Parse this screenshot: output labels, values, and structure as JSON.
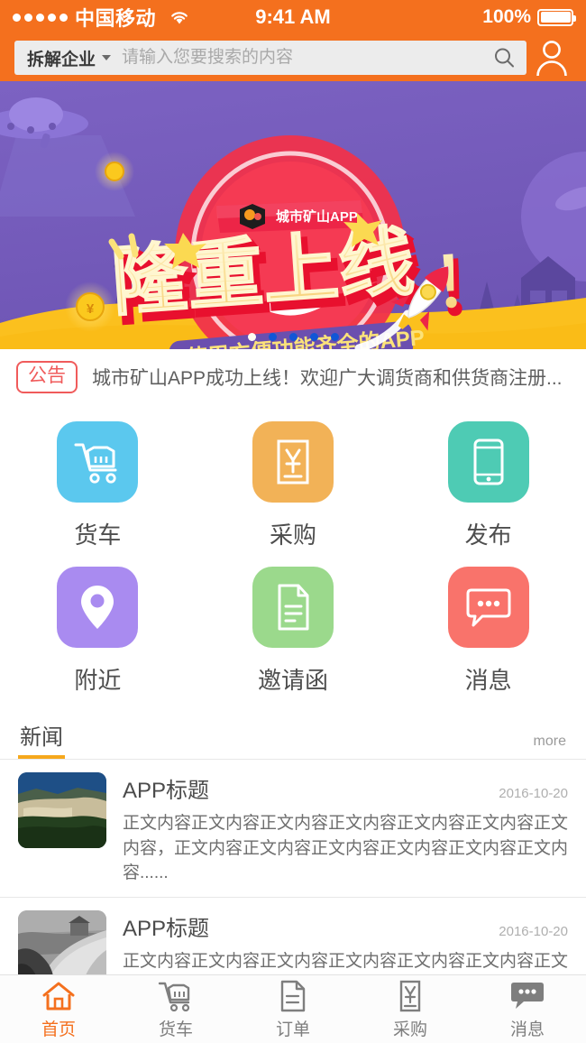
{
  "theme": {
    "accent": "#F4701E",
    "banner_purple": "#7159B8",
    "banner_yellow": "#FBC01E",
    "banner_red": "#F0314B",
    "notice_red": "#F05B5B",
    "news_underline": "#F6A81C"
  },
  "status_bar": {
    "signal_dots": 5,
    "carrier": "中国移动",
    "wifi_icon": "wifi-icon",
    "time": "9:41 AM",
    "battery_percent": "100%",
    "battery_icon": "battery-full-icon"
  },
  "header": {
    "category": {
      "label": "拆解企业",
      "caret_icon": "chevron-down-icon"
    },
    "search": {
      "value": "",
      "placeholder": "请输入您要搜索的内容",
      "icon": "search-icon"
    },
    "profile_icon": "user-avatar-icon"
  },
  "banner": {
    "logo_badge": "城市矿山APP",
    "headline": "隆重上线！",
    "subhead": "使用方便功能齐全的APP",
    "decor_icons": [
      "ufo-icon",
      "coin-icon",
      "rocket-icon",
      "star-icon",
      "tree-icon",
      "house-icon",
      "planet-icon",
      "pylon-icon"
    ],
    "dots": {
      "count": 5,
      "active_index": 0
    }
  },
  "notice": {
    "tag": "公告",
    "text": "城市矿山APP成功上线！欢迎广大调货商和供货商注册..."
  },
  "grid": {
    "items": [
      {
        "label": "货车",
        "icon": "shopping-cart-icon",
        "color": "#5BC8EE"
      },
      {
        "label": "采购",
        "icon": "invoice-yuan-icon",
        "color": "#F2B257"
      },
      {
        "label": "发布",
        "icon": "smartphone-icon",
        "color": "#4ECBB4"
      },
      {
        "label": "附近",
        "icon": "map-pin-icon",
        "color": "#A98BF0"
      },
      {
        "label": "邀请函",
        "icon": "document-icon",
        "color": "#9BD98C"
      },
      {
        "label": "消息",
        "icon": "chat-bubble-icon",
        "color": "#F9736B"
      }
    ]
  },
  "news": {
    "tab_label": "新闻",
    "more_label": "more",
    "items": [
      {
        "thumb": "quarry-photo",
        "title": "APP标题",
        "date": "2016-10-20",
        "desc": "正文内容正文内容正文内容正文内容正文内容正文内容正文内容，正文内容正文内容正文内容正文内容正文内容正文内容......"
      },
      {
        "thumb": "mine-road-photo",
        "title": "APP标题",
        "date": "2016-10-20",
        "desc": "正文内容正文内容正文内容正文内容正文内容正文内容正文内容，正文内容正文内容正文内容正文内容正文内容正文内容......"
      }
    ]
  },
  "tabbar": {
    "active_index": 0,
    "items": [
      {
        "label": "首页",
        "icon": "home-icon"
      },
      {
        "label": "货车",
        "icon": "shopping-cart-icon"
      },
      {
        "label": "订单",
        "icon": "document-icon"
      },
      {
        "label": "采购",
        "icon": "invoice-yuan-icon"
      },
      {
        "label": "消息",
        "icon": "chat-bubble-icon"
      }
    ]
  }
}
